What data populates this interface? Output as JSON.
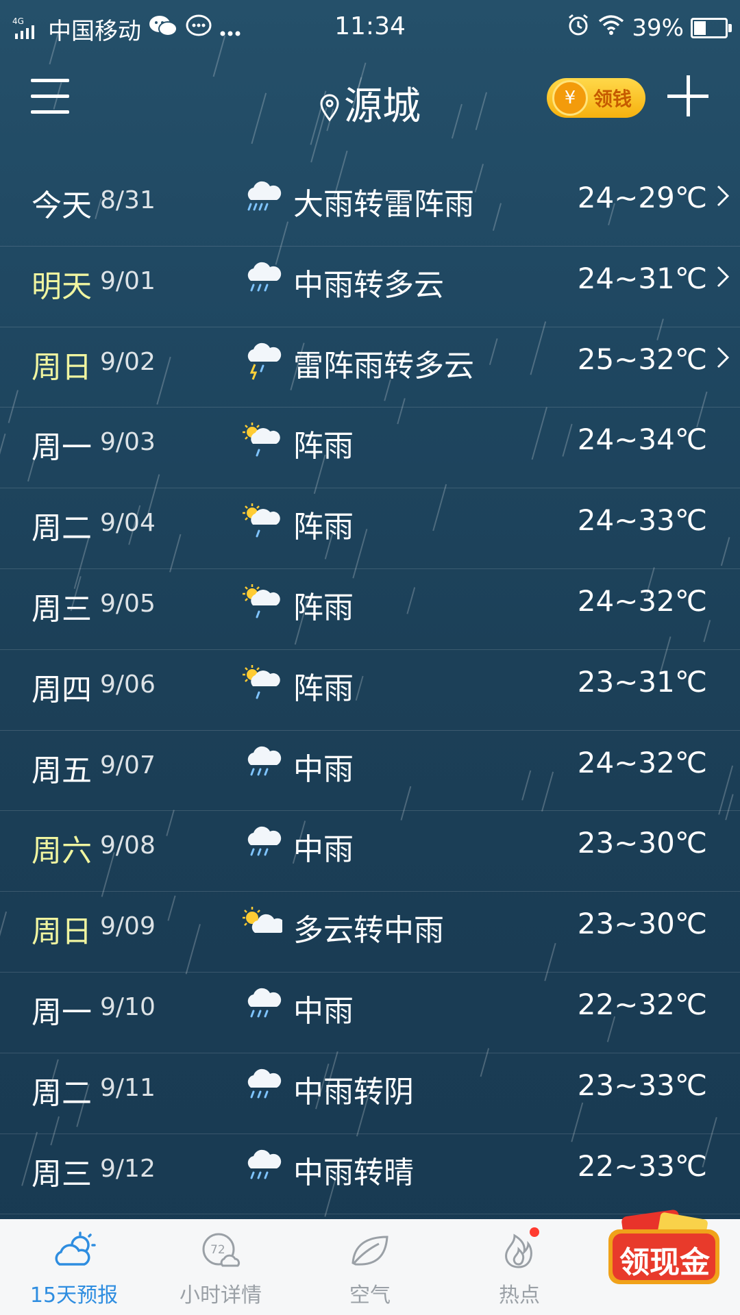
{
  "status_bar": {
    "network": "4G",
    "carrier": "中国移动",
    "time": "11:34",
    "battery": "39%",
    "battery_level": 0.39
  },
  "header": {
    "city": "源城",
    "coin_label": "领钱",
    "coin_symbol": "¥"
  },
  "forecast": [
    {
      "day": "今天",
      "date": "8/31",
      "icon": "heavy-rain-icon",
      "condition": "大雨转雷阵雨",
      "temp": "24~29℃",
      "chevron": true,
      "highlight": false
    },
    {
      "day": "明天",
      "date": "9/01",
      "icon": "rain-icon",
      "condition": "中雨转多云",
      "temp": "24~31℃",
      "chevron": true,
      "highlight": true
    },
    {
      "day": "周日",
      "date": "9/02",
      "icon": "thunder-rain-icon",
      "condition": "雷阵雨转多云",
      "temp": "25~32℃",
      "chevron": true,
      "highlight": true
    },
    {
      "day": "周一",
      "date": "9/03",
      "icon": "sun-shower-icon",
      "condition": "阵雨",
      "temp": "24~34℃",
      "chevron": false,
      "highlight": false
    },
    {
      "day": "周二",
      "date": "9/04",
      "icon": "sun-shower-icon",
      "condition": "阵雨",
      "temp": "24~33℃",
      "chevron": false,
      "highlight": false
    },
    {
      "day": "周三",
      "date": "9/05",
      "icon": "sun-shower-icon",
      "condition": "阵雨",
      "temp": "24~32℃",
      "chevron": false,
      "highlight": false
    },
    {
      "day": "周四",
      "date": "9/06",
      "icon": "sun-shower-icon",
      "condition": "阵雨",
      "temp": "23~31℃",
      "chevron": false,
      "highlight": false
    },
    {
      "day": "周五",
      "date": "9/07",
      "icon": "rain-icon",
      "condition": "中雨",
      "temp": "24~32℃",
      "chevron": false,
      "highlight": false
    },
    {
      "day": "周六",
      "date": "9/08",
      "icon": "rain-icon",
      "condition": "中雨",
      "temp": "23~30℃",
      "chevron": false,
      "highlight": true
    },
    {
      "day": "周日",
      "date": "9/09",
      "icon": "partly-cloudy-icon",
      "condition": "多云转中雨",
      "temp": "23~30℃",
      "chevron": false,
      "highlight": true
    },
    {
      "day": "周一",
      "date": "9/10",
      "icon": "rain-icon",
      "condition": "中雨",
      "temp": "22~32℃",
      "chevron": false,
      "highlight": false
    },
    {
      "day": "周二",
      "date": "9/11",
      "icon": "rain-icon",
      "condition": "中雨转阴",
      "temp": "23~33℃",
      "chevron": false,
      "highlight": false
    },
    {
      "day": "周三",
      "date": "9/12",
      "icon": "rain-icon",
      "condition": "中雨转晴",
      "temp": "22~33℃",
      "chevron": false,
      "highlight": false
    }
  ],
  "bottom_nav": [
    {
      "label": "15天预报",
      "icon": "forecast-15day-icon",
      "active": true
    },
    {
      "label": "小时详情",
      "icon": "hourly-72-icon",
      "badge": "72",
      "active": false
    },
    {
      "label": "空气",
      "icon": "leaf-icon",
      "active": false
    },
    {
      "label": "热点",
      "icon": "flame-icon",
      "active": false,
      "dot": true
    }
  ],
  "cash_button": {
    "label": "领现金"
  }
}
